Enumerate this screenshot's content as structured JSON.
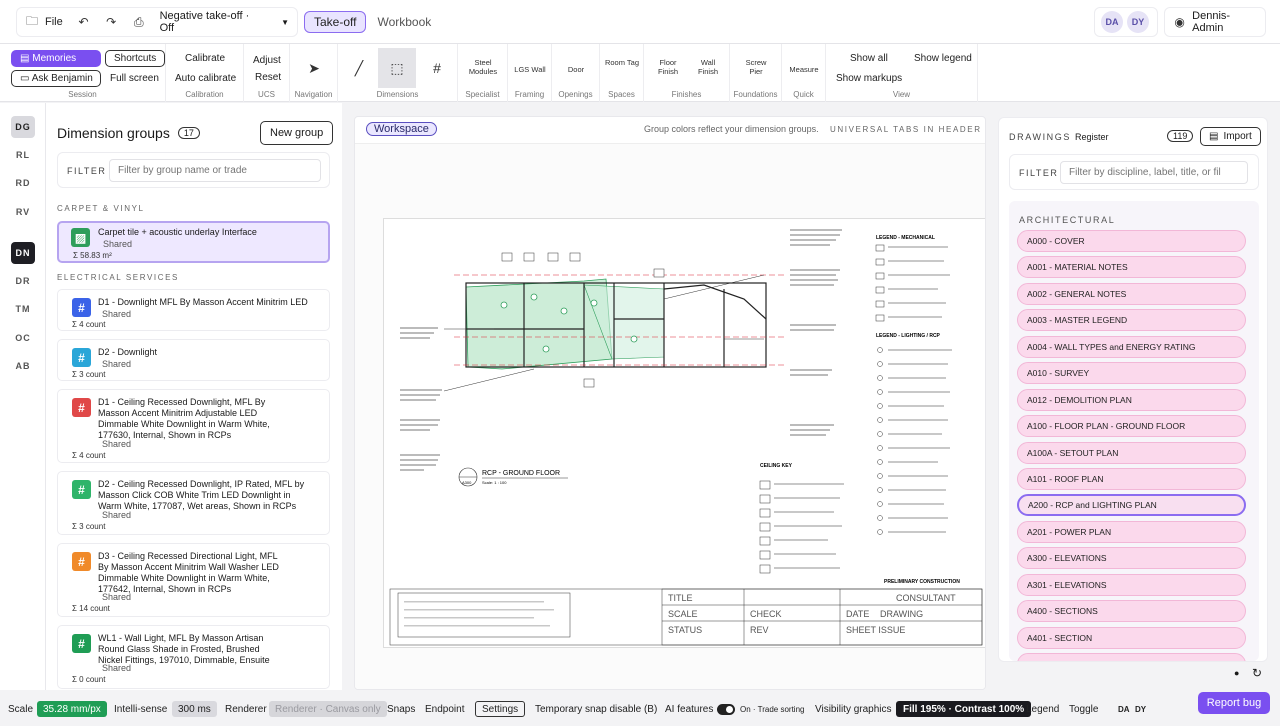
{
  "topbar": {
    "file_label": "File",
    "negative_takeoff": "Negative take-off · Off",
    "tabs": [
      {
        "label": "Take-off",
        "active": true
      },
      {
        "label": "Workbook",
        "active": false
      }
    ],
    "avatars": [
      "DA",
      "DY"
    ],
    "user": "Dennis-Admin"
  },
  "ribbon": {
    "session": {
      "label": "Session",
      "memories": "Memories",
      "shortcuts": "Shortcuts",
      "ask": "Ask Benjamin",
      "fullscreen": "Full screen"
    },
    "calibration": {
      "label": "Calibration",
      "calibrate": "Calibrate",
      "auto": "Auto calibrate"
    },
    "ucs": {
      "label": "UCS",
      "adjust": "Adjust",
      "reset": "Reset"
    },
    "navigation": {
      "label": "Navigation"
    },
    "dimensions": {
      "label": "Dimensions"
    },
    "specialist": {
      "label": "Specialist",
      "item": "Steel Modules"
    },
    "framing": {
      "label": "Framing",
      "item": "LGS Wall"
    },
    "openings": {
      "label": "Openings",
      "item": "Door"
    },
    "spaces": {
      "label": "Spaces",
      "item": "Room Tag"
    },
    "finishes": {
      "label": "Finishes",
      "floor": "Floor Finish",
      "wall": "Wall Finish"
    },
    "foundations": {
      "label": "Foundations",
      "item": "Screw Pier"
    },
    "quick": {
      "label": "Quick",
      "item": "Measure"
    },
    "view": {
      "label": "View",
      "show_all": "Show all",
      "show_legend": "Show legend",
      "show_markups": "Show markups"
    }
  },
  "rail": [
    "DG",
    "RL",
    "RD",
    "RV",
    "DN",
    "DR",
    "TM",
    "OC",
    "AB"
  ],
  "dimension_panel": {
    "title": "Dimension groups",
    "count": "17",
    "new_group": "New group",
    "filter_label": "FILTER",
    "filter_placeholder": "Filter by group name or trade",
    "sections": [
      {
        "label": "CARPET & VINYL"
      },
      {
        "label": "ELECTRICAL SERVICES"
      }
    ],
    "groups": [
      {
        "name": "Carpet tile + acoustic underlay Interface",
        "shared": "Shared",
        "count": "Σ 58.83 m²",
        "color": "#2e9e5b"
      },
      {
        "name": "D1 - Downlight MFL By Masson Accent Minitrim LED",
        "shared": "Shared",
        "count": "Σ 4 count",
        "color": "#3b63e8"
      },
      {
        "name": "D2 - Downlight",
        "shared": "Shared",
        "count": "Σ 3 count",
        "color": "#2aa6d8"
      },
      {
        "name": "D1 - Ceiling Recessed Downlight, MFL By Masson Accent Minitrim Adjustable LED Dimmable White Downlight in Warm White, 177630, Internal, Shown in RCPs",
        "shared": "Shared",
        "count": "Σ 4 count",
        "color": "#e04848"
      },
      {
        "name": "D2 - Ceiling Recessed Downlight, IP Rated, MFL by Masson Click COB White Trim LED Downlight in Warm White, 177087, Wet areas, Shown in RCPs",
        "shared": "Shared",
        "count": "Σ 3 count",
        "color": "#2fb46a"
      },
      {
        "name": "D3 - Ceiling Recessed Directional Light, MFL By Masson Accent Minitrim Wall Washer LED Dimmable White Downlight in Warm White, 177642, Internal, Shown in RCPs",
        "shared": "Shared",
        "count": "Σ 14 count",
        "color": "#f08a2a"
      },
      {
        "name": "WL1 - Wall Light, MFL By Masson Artisan Round Glass Shade in Frosted, Brushed Nickel Fittings, 197010, Dimmable, Ensuite",
        "shared": "Shared",
        "count": "Σ 0 count",
        "color": "#1f9d55"
      }
    ]
  },
  "workspace": {
    "tag": "Workspace",
    "note": "Group colors reflect your dimension groups.",
    "universal": "UNIVERSAL TABS IN HEADER",
    "drawing": {
      "title_ref": "A300",
      "title": "RCP - GROUND FLOOR",
      "scale": "Scale: 1 : 100",
      "legend_mech": "LEGEND - MECHANICAL",
      "legend_light": "LEGEND - LIGHTING / RCP",
      "ceiling_key": "CEILING KEY",
      "preliminary": "PRELIMINARY CONSTRUCTION",
      "tb_title": "TITLE",
      "tb_consultant": "CONSULTANT",
      "tb_scale": "SCALE",
      "tb_check": "CHECK",
      "tb_date": "DATE",
      "tb_drawing": "DRAWING",
      "tb_status": "STATUS",
      "tb_rev": "REV",
      "tb_sheet": "SHEET ISSUE"
    }
  },
  "drawings_panel": {
    "heading": "DRAWINGS",
    "register": "Register",
    "count": "119",
    "import": "Import",
    "filter_label": "FILTER",
    "filter_placeholder": "Filter by discipline, label, title, or fil",
    "category": "ARCHITECTURAL",
    "items": [
      {
        "label": "A000 - COVER",
        "selected": false
      },
      {
        "label": "A001 - MATERIAL NOTES",
        "selected": false
      },
      {
        "label": "A002 - GENERAL NOTES",
        "selected": false
      },
      {
        "label": "A003 - MASTER LEGEND",
        "selected": false
      },
      {
        "label": "A004 - WALL TYPES and ENERGY RATING",
        "selected": false
      },
      {
        "label": "A010 - SURVEY",
        "selected": false
      },
      {
        "label": "A012 - DEMOLITION PLAN",
        "selected": false
      },
      {
        "label": "A100 - FLOOR PLAN - GROUND FLOOR",
        "selected": false
      },
      {
        "label": "A100A - SETOUT PLAN",
        "selected": false
      },
      {
        "label": "A101 - ROOF PLAN",
        "selected": false
      },
      {
        "label": "A200 - RCP and LIGHTING PLAN",
        "selected": true
      },
      {
        "label": "A201 - POWER PLAN",
        "selected": false
      },
      {
        "label": "A300 - ELEVATIONS",
        "selected": false
      },
      {
        "label": "A301 - ELEVATIONS",
        "selected": false
      },
      {
        "label": "A400 - SECTIONS",
        "selected": false
      },
      {
        "label": "A401 - SECTION",
        "selected": false
      }
    ]
  },
  "statusbar": {
    "scale_label": "Scale",
    "scale_value": "35.28 mm/px",
    "intellisense": "Intelli-sense",
    "ms": "300 ms",
    "renderer": "Renderer",
    "renderer_value": "Renderer · Canvas only",
    "snaps": "Snaps",
    "endpoint": "Endpoint",
    "settings": "Settings",
    "temp_snap": "Temporary snap disable (B)",
    "ai": "AI features",
    "trade_sorting": "On · Trade sorting",
    "visibility": "Visibility graphics",
    "fill": "Fill 195% · Contrast 100%",
    "legend": "Legend",
    "toggle": "Toggle",
    "avatars": [
      "DA",
      "DY"
    ],
    "report_bug": "Report bug"
  }
}
